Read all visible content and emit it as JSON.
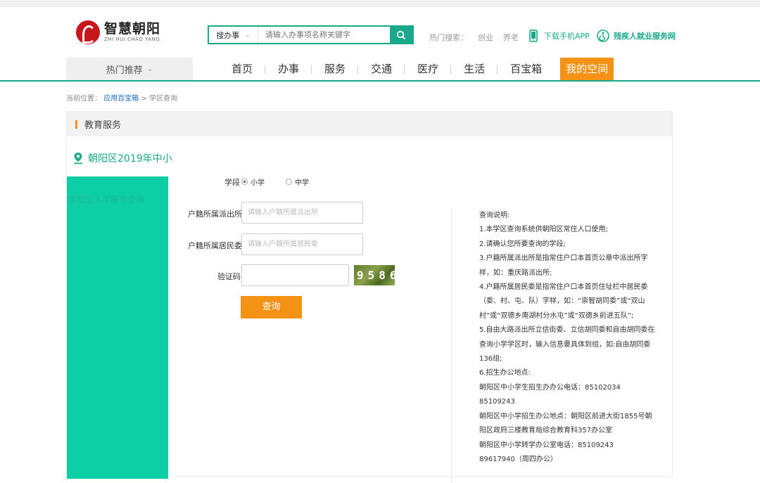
{
  "header": {
    "logo_cn": "智慧朝阳",
    "logo_en": "ZHI HUI CHAO YANG",
    "search_type": "搜办事",
    "search_placeholder": "请输入办事项名称关键字",
    "hot_label": "热门搜索：",
    "hot_terms": [
      "创业",
      "养老"
    ],
    "app_download": "下载手机APP",
    "service_link": "残疾人就业服务网"
  },
  "nav": {
    "hot_recommend": "热门推荐",
    "items": [
      "首页",
      "办事",
      "服务",
      "交通",
      "医疗",
      "生活",
      "百宝箱",
      "我的空间"
    ]
  },
  "breadcrumb": {
    "prefix": "当前位置：",
    "link": "应用百宝箱",
    "sep": ">",
    "current": "学区查询"
  },
  "panel": {
    "title": "教育服务",
    "location_title": "朝阳区2019年中小",
    "sidebar_text": "学招生入学服务查询"
  },
  "form": {
    "level_label": "学段",
    "level_options": [
      "小学",
      "中学"
    ],
    "level_selected": "小学",
    "police_label": "户籍所属派出所",
    "police_placeholder": "请输入户籍所属派出所",
    "committee_label": "户籍所属居民委",
    "committee_placeholder": "请输入户籍所属居民委",
    "captcha_label": "验证码",
    "captcha_code": "9586",
    "submit_label": "查询"
  },
  "notes": [
    "查询说明:",
    "1.本学区查询系统供朝阳区常住人口使用;",
    "2.请确认您所要查询的学段;",
    "3.户籍所属派出所是指常住户口本首页公章中派出所字样，如：重庆路派出所;",
    "4.户籍所属居民委是指常住户口本首页住址栏中居民委（委、村、屯、队）字样，如：“崇智胡同委”或“双山村”或“双德乡南湖村分水屯”或“双德乡前进五队”;",
    "5.自由大路派出所立信街委、立信胡同委和自由胡同委在查询小学学区时，输入信息要具体到组，如:自由胡同委136组;",
    "6.招生办公地点:",
    "朝阳区中小学生招生办办公电话：85102034 85109243",
    "朝阳区中小学招生办公地点：朝阳区前进大街1855号朝阳区政府三楼教育局综合教育科357办公室",
    "朝阳区中小学转学办公室电话：85109243",
    "89617940（周四办公）"
  ],
  "colors": {
    "brand_green": "#1aa98a",
    "accent_orange": "#f39215",
    "sidebar_teal": "#0ccfa6",
    "logo_red": "#c8161d"
  }
}
